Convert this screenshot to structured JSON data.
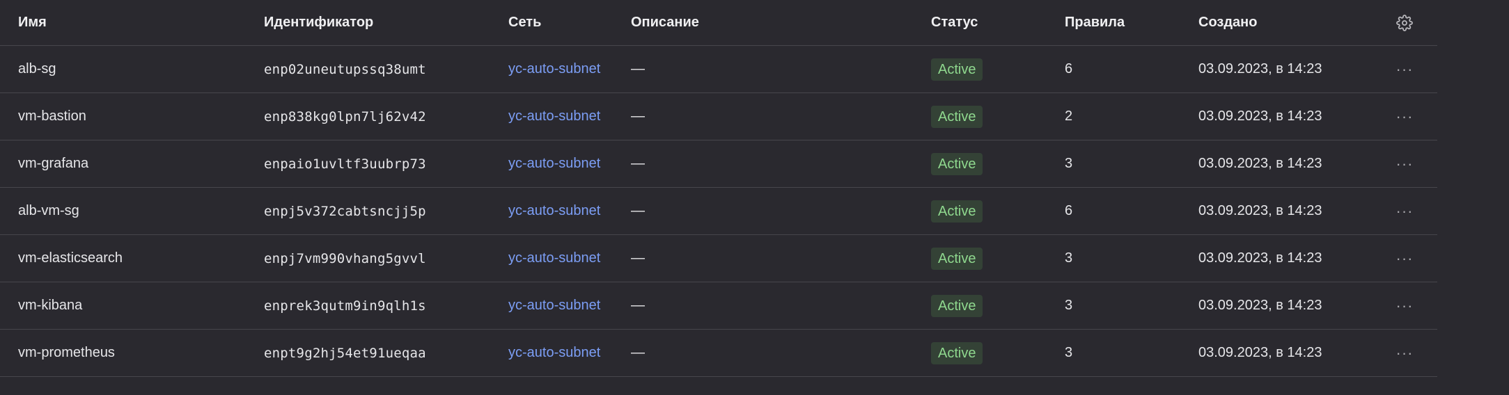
{
  "table": {
    "columns": {
      "name": "Имя",
      "id": "Идентификатор",
      "network": "Сеть",
      "description": "Описание",
      "status": "Статус",
      "rules": "Правила",
      "created": "Создано"
    },
    "settings_icon": "gear-icon",
    "action_icon": "more-dots-icon",
    "rows": [
      {
        "name": "alb-sg",
        "id": "enp02uneutupssq38umt",
        "network": "yc-auto-subnet",
        "description": "—",
        "status": "Active",
        "rules": "6",
        "created": "03.09.2023, в 14:23",
        "action": "···"
      },
      {
        "name": "vm-bastion",
        "id": "enp838kg0lpn7lj62v42",
        "network": "yc-auto-subnet",
        "description": "—",
        "status": "Active",
        "rules": "2",
        "created": "03.09.2023, в 14:23",
        "action": "···"
      },
      {
        "name": "vm-grafana",
        "id": "enpaio1uvltf3uubrp73",
        "network": "yc-auto-subnet",
        "description": "—",
        "status": "Active",
        "rules": "3",
        "created": "03.09.2023, в 14:23",
        "action": "···"
      },
      {
        "name": "alb-vm-sg",
        "id": "enpj5v372cabtsncjj5p",
        "network": "yc-auto-subnet",
        "description": "—",
        "status": "Active",
        "rules": "6",
        "created": "03.09.2023, в 14:23",
        "action": "···"
      },
      {
        "name": "vm-elasticsearch",
        "id": "enpj7vm990vhang5gvvl",
        "network": "yc-auto-subnet",
        "description": "—",
        "status": "Active",
        "rules": "3",
        "created": "03.09.2023, в 14:23",
        "action": "···"
      },
      {
        "name": "vm-kibana",
        "id": "enprek3qutm9in9qlh1s",
        "network": "yc-auto-subnet",
        "description": "—",
        "status": "Active",
        "rules": "3",
        "created": "03.09.2023, в 14:23",
        "action": "···"
      },
      {
        "name": "vm-prometheus",
        "id": "enpt9g2hj54et91ueqaa",
        "network": "yc-auto-subnet",
        "description": "—",
        "status": "Active",
        "rules": "3",
        "created": "03.09.2023, в 14:23",
        "action": "···"
      }
    ]
  },
  "colors": {
    "background": "#2a292f",
    "link": "#7c9ef5",
    "status_active_bg": "#344236",
    "status_active_text": "#8fd88e",
    "divider": "#47464c"
  }
}
